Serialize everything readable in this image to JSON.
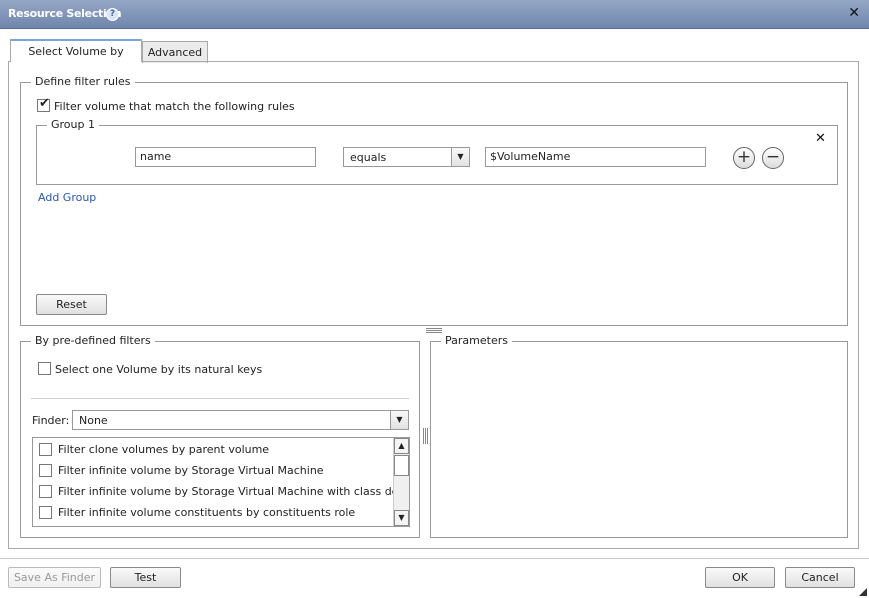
{
  "dialog": {
    "title": "Resource Selection",
    "help_glyph": "?",
    "close_glyph": "✕"
  },
  "tabs": [
    {
      "label": "Select Volume by",
      "active": true
    },
    {
      "label": "Advanced",
      "active": false
    }
  ],
  "filter_rules": {
    "legend": "Define filter rules",
    "enable_checkbox": {
      "label": "Filter volume that match the following rules",
      "checked": true
    },
    "group": {
      "legend": "Group 1",
      "remove_glyph": "✕",
      "rule": {
        "field": "name",
        "operator": "equals",
        "value": "$VolumeName"
      },
      "add_glyph": "+",
      "remove_rule_glyph": "−"
    },
    "add_group_label": "Add Group",
    "reset_label": "Reset"
  },
  "predefined": {
    "legend": "By pre-defined filters",
    "natural_keys_checkbox": {
      "label": "Select one Volume by its natural keys",
      "checked": false
    },
    "finder_label": "Finder:",
    "finder_value": "None",
    "filters": [
      {
        "label": "Filter clone volumes by parent volume",
        "checked": false
      },
      {
        "label": "Filter infinite volume by Storage Virtual Machine",
        "checked": false
      },
      {
        "label": "Filter infinite volume by Storage Virtual Machine with class details",
        "checked": false
      },
      {
        "label": "Filter infinite volume constituents by constituents role",
        "checked": false
      }
    ]
  },
  "parameters": {
    "legend": "Parameters"
  },
  "footer": {
    "save_as_finder": "Save As Finder",
    "test": "Test",
    "ok": "OK",
    "cancel": "Cancel"
  },
  "colors": {
    "titlebar": "#7f94b8",
    "link": "#2a57b8",
    "tab_active_top": "#79a6d6"
  }
}
